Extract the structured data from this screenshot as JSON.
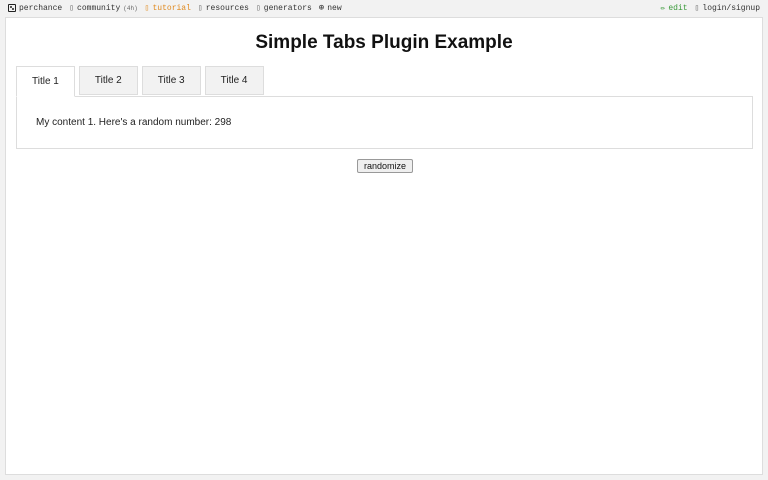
{
  "nav": {
    "brand": "perchance",
    "community": "community",
    "community_count": "(4h)",
    "tutorial": "tutorial",
    "resources": "resources",
    "generators": "generators",
    "new": "new",
    "edit": "edit",
    "login": "login/signup"
  },
  "page": {
    "title": "Simple Tabs Plugin Example"
  },
  "tabs": [
    {
      "label": "Title 1",
      "active": true
    },
    {
      "label": "Title 2",
      "active": false
    },
    {
      "label": "Title 3",
      "active": false
    },
    {
      "label": "Title 4",
      "active": false
    }
  ],
  "content": {
    "text": "My content 1. Here's a random number: 298"
  },
  "actions": {
    "randomize_label": "randomize"
  }
}
